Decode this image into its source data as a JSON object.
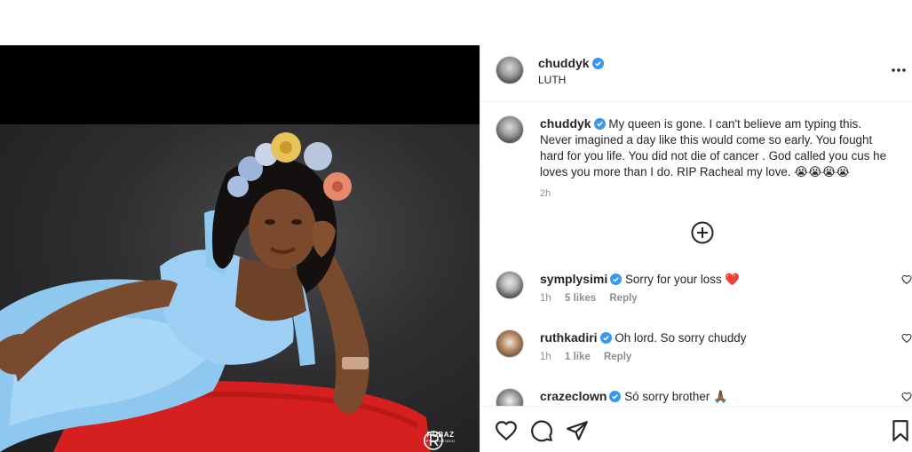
{
  "post": {
    "author": "chuddyk",
    "location": "LUTH",
    "caption": "My queen is gone. I can't believe am typing this. Never imagined a day like this would come so early. You fought hard for you life. You did not die of cancer . God called you cus he loves you more than I do. RIP Racheal my love.",
    "caption_emojis": "😭😭😭😭",
    "time": "2h",
    "image_watermark": {
      "brand": "ROBAZ",
      "sub": "PHOTOSTUDIO"
    }
  },
  "comments": [
    {
      "user": "symplysimi",
      "verified": true,
      "text": "Sorry for your loss",
      "emoji": "❤️",
      "time": "1h",
      "likes": "5 likes",
      "reply_label": "Reply"
    },
    {
      "user": "ruthkadiri",
      "verified": true,
      "text": "Oh lord. So sorry chuddy",
      "emoji": "",
      "time": "1h",
      "likes": "1 like",
      "reply_label": "Reply"
    },
    {
      "user": "crazeclown",
      "verified": true,
      "text": "Só sorry brother",
      "emoji": "🙏🏾",
      "time": "",
      "likes": "",
      "reply_label": ""
    }
  ],
  "icons": {
    "more": "more-options-icon",
    "load_more": "plus-circle-icon",
    "like": "heart-icon",
    "comment": "comment-bubble-icon",
    "share": "paper-plane-icon",
    "save": "bookmark-icon",
    "verified": "verified-badge-icon"
  },
  "colors": {
    "verified_blue": "#3897f0",
    "text": "#262626",
    "muted": "#8e8e8e",
    "heart_red": "#e0245e"
  }
}
